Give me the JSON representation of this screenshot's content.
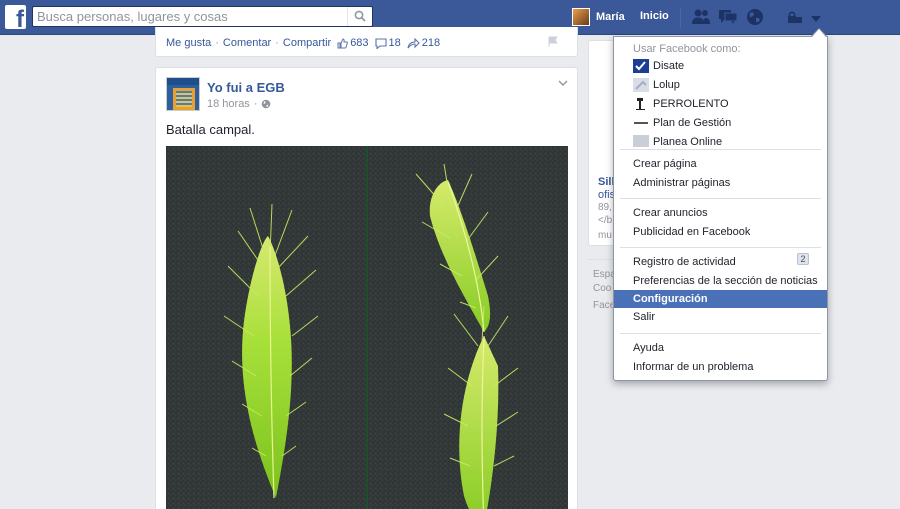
{
  "header": {
    "search_placeholder": "Busca personas, lugares y cosas",
    "profile_name": "María",
    "home_label": "Inicio"
  },
  "previous_post": {
    "like_label": "Me gusta",
    "comment_label": "Comentar",
    "share_label": "Compartir",
    "likes": "683",
    "comments": "18",
    "shares": "218"
  },
  "post": {
    "page_name": "Yo fui a EGB",
    "time": "18 horas",
    "text": "Batalla campal."
  },
  "right_column": {
    "ad_title": "Sill",
    "ad_line2": "ofis",
    "ad_line3": "89,",
    "ad_line4": "</b",
    "ad_line5": "mu",
    "footer1": "Espa",
    "footer2": "Coo",
    "footer3": "Face"
  },
  "menu": {
    "use_as_label": "Usar Facebook como:",
    "accounts": [
      {
        "label": "Disate",
        "icon": "disate-page-icon"
      },
      {
        "label": "Lolup",
        "icon": "lolup-page-icon"
      },
      {
        "label": "PERROLENTO",
        "icon": "perrolento-page-icon"
      },
      {
        "label": "Plan de Gestión",
        "icon": "plan-page-icon"
      },
      {
        "label": "Planea Online",
        "icon": "planea-page-icon"
      }
    ],
    "create_page": "Crear página",
    "manage_pages": "Administrar páginas",
    "create_ads": "Crear anuncios",
    "advertise": "Publicidad en Facebook",
    "activity_log": "Registro de actividad",
    "activity_badge": "2",
    "news_feed_prefs": "Preferencias de la sección de noticias",
    "settings": "Configuración",
    "logout": "Salir",
    "help": "Ayuda",
    "report_problem": "Informar de un problema"
  },
  "colors": {
    "brand_blue": "#3b5998",
    "link_blue": "#365899",
    "menu_highlight": "#4a70b7",
    "page_bg": "#e9ebee",
    "grain_green": "#a8e03a"
  }
}
